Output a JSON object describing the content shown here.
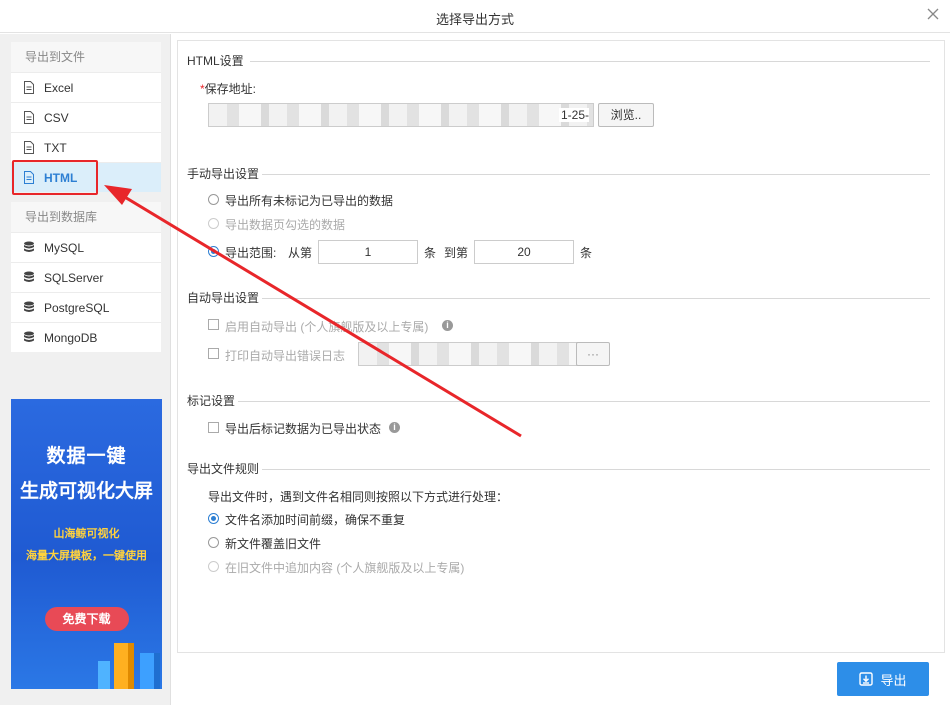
{
  "dialog": {
    "title": "选择导出方式"
  },
  "sidebar": {
    "file_group_title": "导出到文件",
    "file_items": [
      {
        "label": "Excel",
        "icon": "file-icon"
      },
      {
        "label": "CSV",
        "icon": "file-icon"
      },
      {
        "label": "TXT",
        "icon": "file-icon"
      },
      {
        "label": "HTML",
        "icon": "file-icon",
        "active": true
      }
    ],
    "db_group_title": "导出到数据库",
    "db_items": [
      {
        "label": "MySQL",
        "icon": "database-icon"
      },
      {
        "label": "SQLServer",
        "icon": "database-icon"
      },
      {
        "label": "PostgreSQL",
        "icon": "database-icon"
      },
      {
        "label": "MongoDB",
        "icon": "database-icon"
      }
    ]
  },
  "ad": {
    "line1": "数据一键",
    "line2": "生成可视化大屏",
    "sub1": "山海鲸可视化",
    "sub2": "海量大屏模板，一键使用",
    "button": "免费下载"
  },
  "html_settings": {
    "section_title": "HTML设置",
    "save_path_label": "保存地址:",
    "required_mark": "*",
    "save_path_value": "1-25-",
    "browse_button": "浏览.."
  },
  "manual": {
    "section_title": "手动导出设置",
    "opt_all": "导出所有未标记为已导出的数据",
    "opt_selected": "导出数据页勾选的数据",
    "opt_range": "导出范围:",
    "from_label": "从第",
    "from_value": "1",
    "unit1": "条",
    "to_label": "到第",
    "to_value": "20",
    "unit2": "条"
  },
  "auto": {
    "section_title": "自动导出设置",
    "enable_label": "启用自动导出",
    "enable_note": "(个人旗舰版及以上专属)",
    "log_label": "打印自动导出错误日志",
    "log_button": "···"
  },
  "mark": {
    "section_title": "标记设置",
    "mark_label": "导出后标记数据为已导出状态"
  },
  "rule": {
    "section_title": "导出文件规则",
    "description": "导出文件时，遇到文件名相同则按照以下方式进行处理：",
    "opt_timestamp": "文件名添加时间前缀，确保不重复",
    "opt_overwrite": "新文件覆盖旧文件",
    "opt_append": "在旧文件中追加内容 (个人旗舰版及以上专属)"
  },
  "footer": {
    "export_button": "导出"
  },
  "colors": {
    "accent": "#2d8ee8",
    "highlight": "#e8262a",
    "active_bg": "#dbeefa"
  }
}
